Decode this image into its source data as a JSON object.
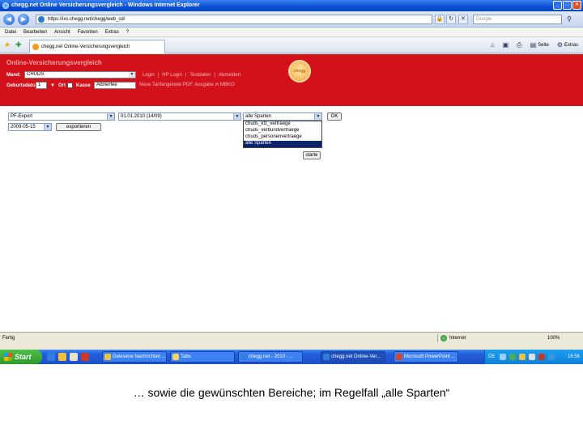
{
  "window": {
    "title": "chegg.net Online Versicherungsvergleich - Windows Internet Explorer",
    "controls": [
      "_",
      "□",
      "×"
    ]
  },
  "addressbar": {
    "url": "https://ixs.chegg.net/chegg/web_cd/",
    "search_placeholder": "Google"
  },
  "menu": [
    "Datei",
    "Bearbeiten",
    "Ansicht",
    "Favoriten",
    "Extras",
    "?"
  ],
  "tabbar": {
    "tab_title": "chegg.net Online-Versicherungsvergleich",
    "commands": [
      "Seite",
      "Extras"
    ]
  },
  "banner": {
    "page_title": "Online-Versicherungsvergleich",
    "logo_text": "chegg",
    "mandant_label": "Mand:",
    "mandant_value": "CHUDS",
    "links": [
      "Login",
      "|",
      "HP Login",
      "|",
      "Testdaten",
      "|",
      "Abmelden"
    ],
    "geburtsdatum_label": "Geburtsdatum",
    "geburtsdatum_value": "1",
    "ort_label": "Ort",
    "kasse_label": "Kasse",
    "kasse_value": "Albnerfee",
    "info_links": "Neue Tarifangebote PDF, Ausgabe in MBKO"
  },
  "form": {
    "export_select": "PF-Export",
    "period_select": "01.01.2010 (14/09)",
    "sparten_select": "alle Sparten",
    "ok_button": "OK",
    "date_select": "2009-05-15",
    "export_button": "exportieren",
    "dropdown_options": [
      "chuds_kfz_vertraege",
      "chuds_verbundvertraege",
      "chuds_personenvertraege",
      "alle Sparten"
    ],
    "dropdown_selected_index": 3,
    "starte_button": "starte"
  },
  "statusbar": {
    "status": "Fertig",
    "zone": "Internet",
    "zoom": "100%"
  },
  "taskbar": {
    "start": "Start",
    "tasks": [
      "Gelesene Nachrichten ...",
      "Tabs",
      "chegg.net - 2010 - ...",
      "chegg.net Online-Ver...",
      "Microsoft PowerPoint ..."
    ],
    "active_task_index": 3,
    "language": "DE",
    "clock": "16:56"
  },
  "caption": "… sowie die gewünschten Bereiche; im Regelfall „alle Sparten“"
}
